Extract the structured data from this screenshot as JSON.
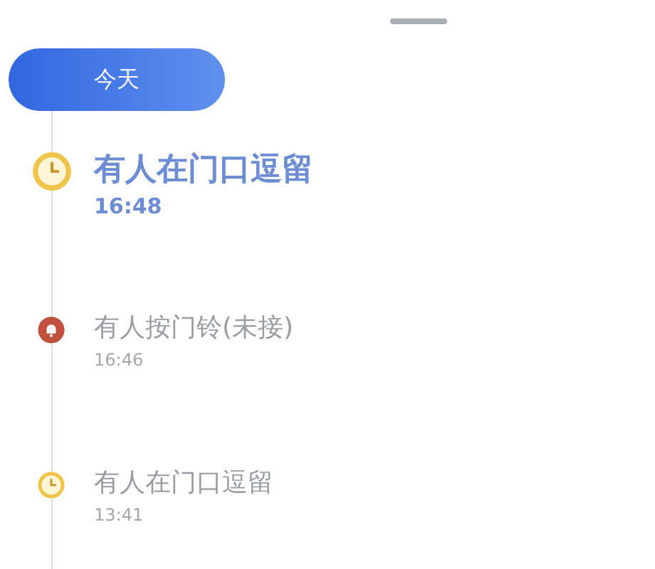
{
  "date_chip": "今天",
  "events": [
    {
      "kind": "loiter",
      "title": "有人在门口逗留",
      "time": "16:48",
      "selected": true
    },
    {
      "kind": "doorbell",
      "title": "有人按门铃(未接)",
      "time": "16:46",
      "selected": false
    },
    {
      "kind": "loiter",
      "title": "有人在门口逗留",
      "time": "13:41",
      "selected": false
    }
  ]
}
